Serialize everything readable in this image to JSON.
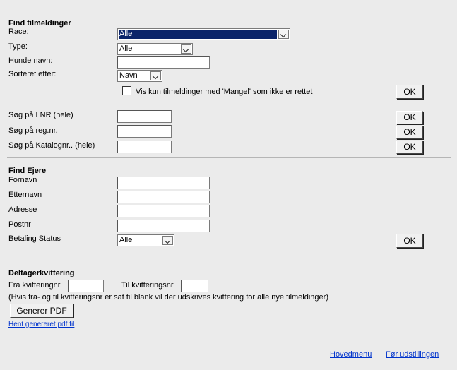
{
  "find_tilmeldinger": {
    "heading": "Find tilmeldinger",
    "race_label": "Race:",
    "race_value": "Alle",
    "type_label": "Type:",
    "type_value": "Alle",
    "hunde_navn_label": "Hunde navn:",
    "hunde_navn_value": "",
    "sorteret_label": "Sorteret efter:",
    "sorteret_value": "Navn",
    "mangel_checkbox_label": "Vis kun tilmeldinger med 'Mangel' som ikke er rettet",
    "mangel_checked": false,
    "ok_label": "OK"
  },
  "search": {
    "lnr_label": "Søg på LNR (hele)",
    "lnr_value": "",
    "regnr_label": "Søg på reg.nr.",
    "regnr_value": "",
    "katalog_label": "Søg på Katalognr.. (hele)",
    "katalog_value": "",
    "ok_label": "OK"
  },
  "find_ejere": {
    "heading": "Find Ejere",
    "fornavn_label": "Fornavn",
    "etternavn_label": "Etternavn",
    "adresse_label": "Adresse",
    "postnr_label": "Postnr",
    "betaling_label": "Betaling Status",
    "betaling_value": "Alle",
    "ok_label": "OK"
  },
  "kvittering": {
    "heading": "Deltagerkvittering",
    "fra_label": "Fra kvitteringnr",
    "til_label": "Til kvitteringsnr",
    "note": "(Hvis fra- og til kvitteringsnr er sat til blank vil der udskrives kvittering for alle nye tilmeldinger)",
    "generate_label": "Generer PDF",
    "download_link": "Hent genereret pdf fil"
  },
  "footer": {
    "hovedmenu": "Hovedmenu",
    "for_udstillingen": "Før udstillingen"
  }
}
